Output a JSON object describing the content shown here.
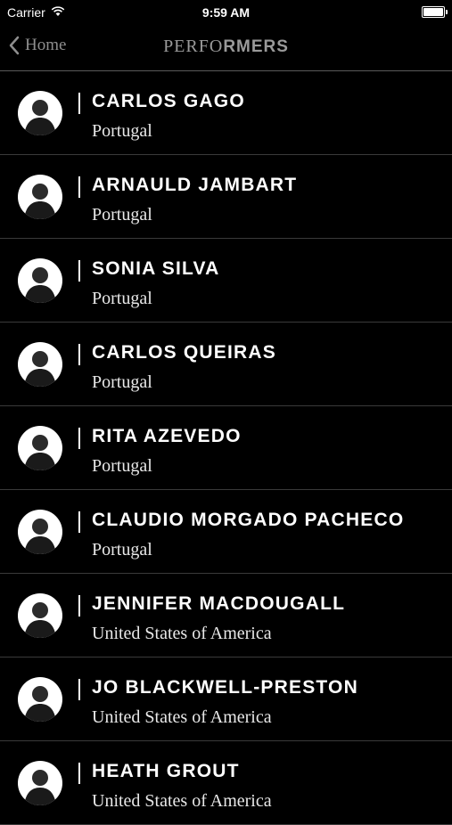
{
  "status": {
    "carrier": "Carrier",
    "time": "9:59 AM"
  },
  "nav": {
    "back_label": "Home",
    "title_light": "PERFO",
    "title_bold": "RMERS"
  },
  "performers": [
    {
      "name": "CARLOS GAGO",
      "country": "Portugal"
    },
    {
      "name": "ARNAULD JAMBART",
      "country": "Portugal"
    },
    {
      "name": "SONIA SILVA",
      "country": "Portugal"
    },
    {
      "name": "CARLOS QUEIRAS",
      "country": "Portugal"
    },
    {
      "name": "RITA AZEVEDO",
      "country": "Portugal"
    },
    {
      "name": "CLAUDIO MORGADO PACHECO",
      "country": "Portugal"
    },
    {
      "name": "JENNIFER MACDOUGALL",
      "country": "United States of America"
    },
    {
      "name": "JO BLACKWELL-PRESTON",
      "country": "United States of America"
    },
    {
      "name": "HEATH GROUT",
      "country": "United States of America"
    }
  ]
}
